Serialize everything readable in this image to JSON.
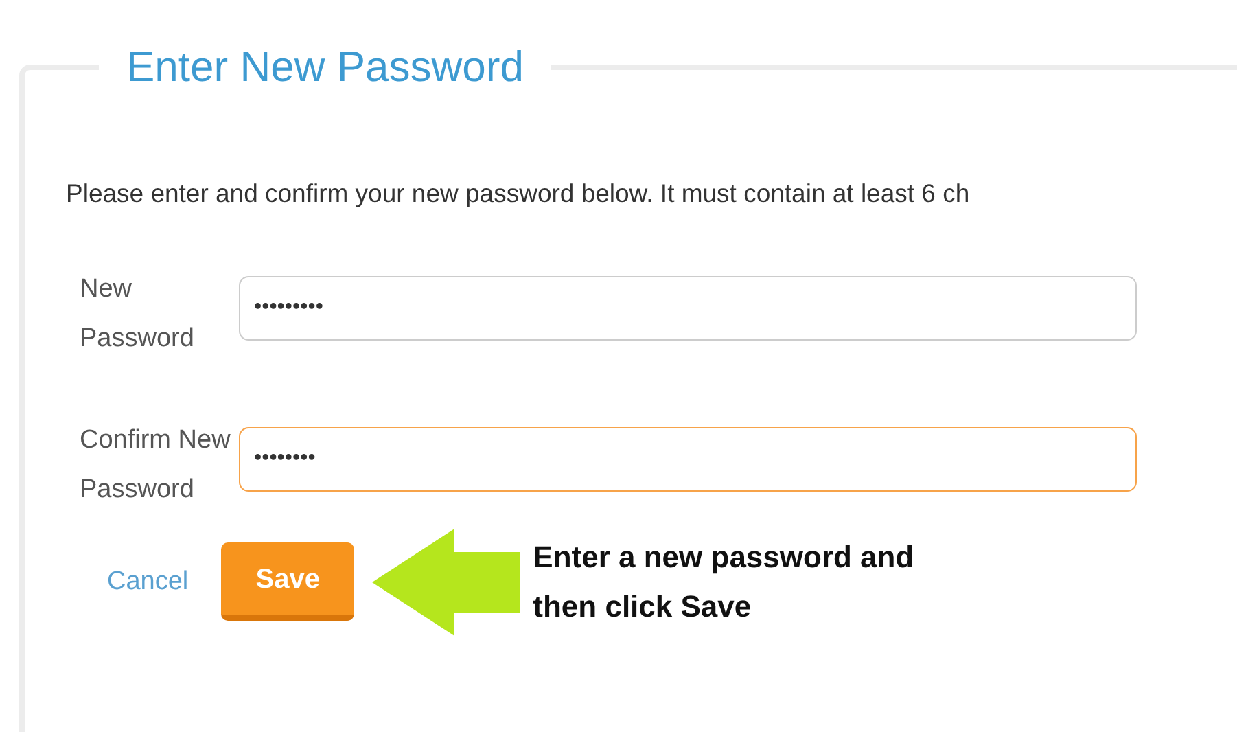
{
  "legend": "Enter New Password",
  "intro": "Please enter and confirm your new password below. It must contain at least 6 ch",
  "fields": [
    {
      "label": "New Password",
      "value": "•••••••••",
      "focused": false
    },
    {
      "label": "Confirm New Password",
      "value": "••••••••",
      "focused": true
    }
  ],
  "cancel": "Cancel",
  "save": "Save",
  "callout": "Enter a new password and then click Save"
}
